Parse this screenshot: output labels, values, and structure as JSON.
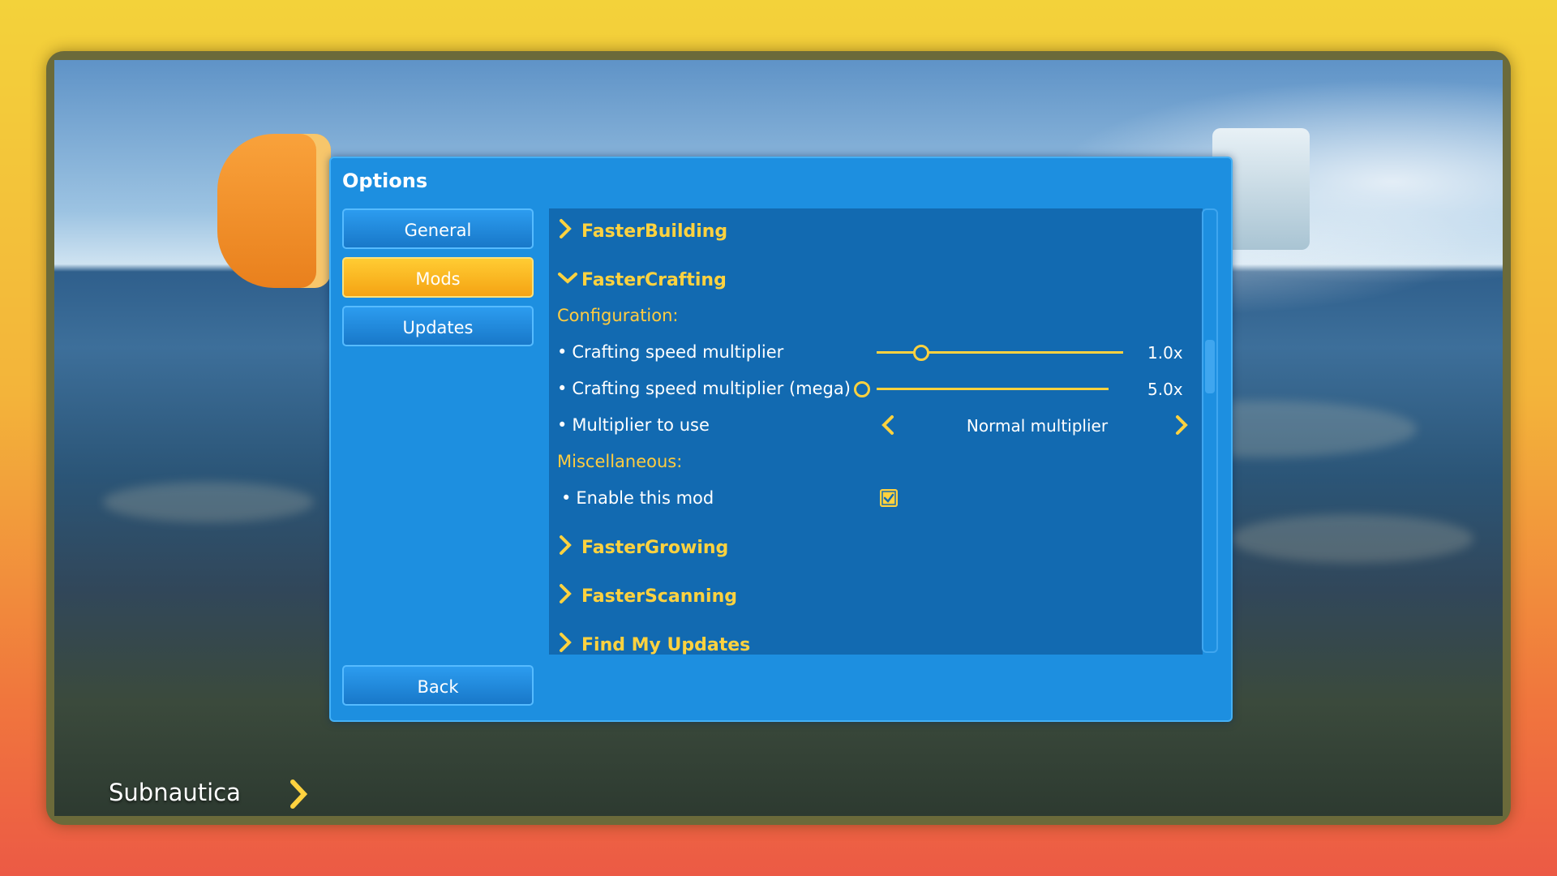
{
  "dialog": {
    "title": "Options",
    "tabs": [
      {
        "label": "General",
        "active": false
      },
      {
        "label": "Mods",
        "active": true
      },
      {
        "label": "Updates",
        "active": false
      }
    ],
    "back_label": "Back"
  },
  "mods": {
    "faster_building": "FasterBuilding",
    "faster_crafting": "FasterCrafting",
    "faster_growing": "FasterGrowing",
    "faster_scanning": "FasterScanning",
    "find_my_updates": "Find My Updates"
  },
  "crafting_config": {
    "configuration_label": "Configuration:",
    "miscellaneous_label": "Miscellaneous:",
    "crafting_speed": {
      "label": "Crafting speed multiplier",
      "value": "1.0x",
      "slider_fraction": 0.18
    },
    "crafting_speed_mega": {
      "label": "Crafting speed multiplier (mega)",
      "value": "5.0x",
      "slider_fraction": 0.0
    },
    "multiplier_to_use": {
      "label": "Multiplier to use",
      "value": "Normal multiplier"
    },
    "enable_mod": {
      "label": "Enable this mod",
      "checked": true
    }
  },
  "footer": {
    "title": "Subnautica"
  },
  "colors": {
    "accent": "#ffd23f",
    "panel": "#126ab1",
    "dialog": "#1d8fe0",
    "active_tab": "#f5a313"
  }
}
